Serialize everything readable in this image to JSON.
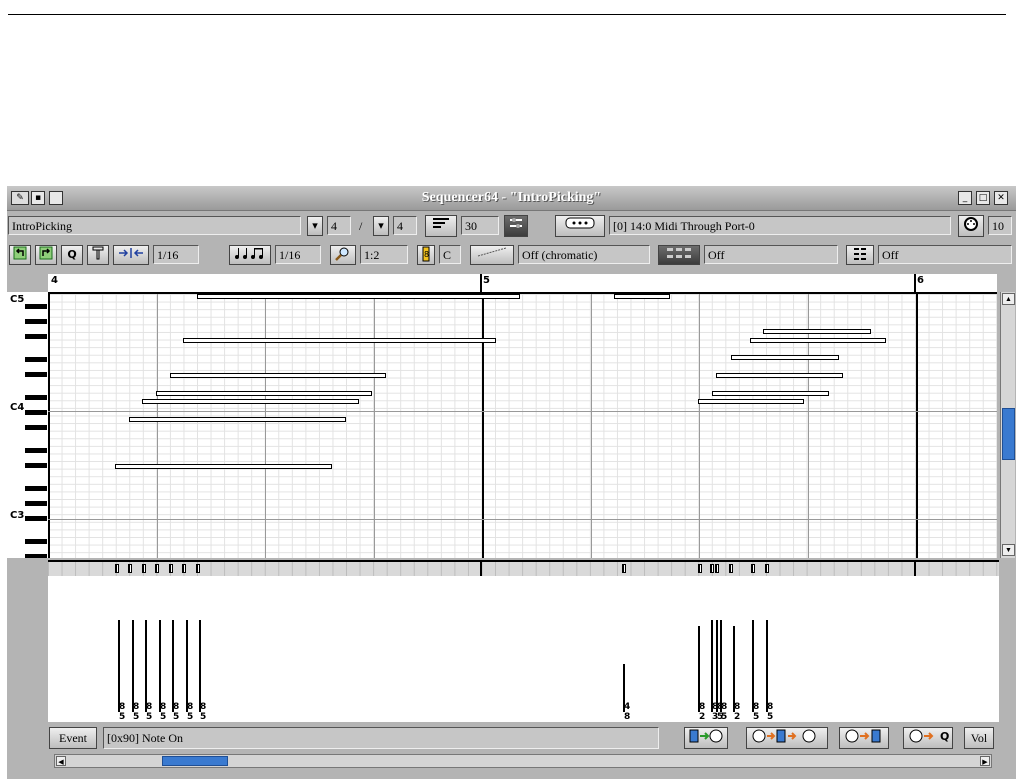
{
  "window": {
    "title": "Sequencer64 - \"IntroPicking\""
  },
  "toolbar1": {
    "seq_name": "IntroPicking",
    "beats_per_bar": "4",
    "separator": "/",
    "beat_width": "4",
    "length": "30",
    "midi_port": "[0] 14:0 Midi Through Port-0",
    "midi_channel": "10"
  },
  "toolbar2": {
    "snap": "1/16",
    "note_length": "1/16",
    "zoom": "1:2",
    "key": "C",
    "scale": "Off (chromatic)",
    "background_seq": "Off",
    "chord": "Off",
    "q_label": "Q"
  },
  "ruler": {
    "measures": [
      "4",
      "5",
      "6"
    ]
  },
  "keyboard": {
    "labels": [
      "C5",
      "C4",
      "C3"
    ]
  },
  "velocity_labels": [
    {
      "top": "8",
      "bottom": "5"
    },
    {
      "top": "8",
      "bottom": "5"
    },
    {
      "top": "8",
      "bottom": "5"
    },
    {
      "top": "8",
      "bottom": "5"
    },
    {
      "top": "8",
      "bottom": "5"
    },
    {
      "top": "8",
      "bottom": "5"
    },
    {
      "top": "8",
      "bottom": "5"
    },
    {
      "top": "4",
      "bottom": "8"
    },
    {
      "top": "8",
      "bottom": "2"
    },
    {
      "top": "8",
      "bottom": "3"
    },
    {
      "top": "8",
      "bottom": "5"
    },
    {
      "top": "8",
      "bottom": "5"
    },
    {
      "top": "8",
      "bottom": "2"
    },
    {
      "top": "8",
      "bottom": "5"
    },
    {
      "top": "8",
      "bottom": "5"
    }
  ],
  "bottom": {
    "event_button": "Event",
    "event_type": "[0x90] Note On",
    "vol_button": "Vol",
    "q_label": "Q"
  },
  "colors": {
    "window_bg": "#b4b4b4",
    "scroll_thumb": "#3a7ad0",
    "arrow_green": "#2a9a2a",
    "arrow_orange": "#e07020"
  }
}
